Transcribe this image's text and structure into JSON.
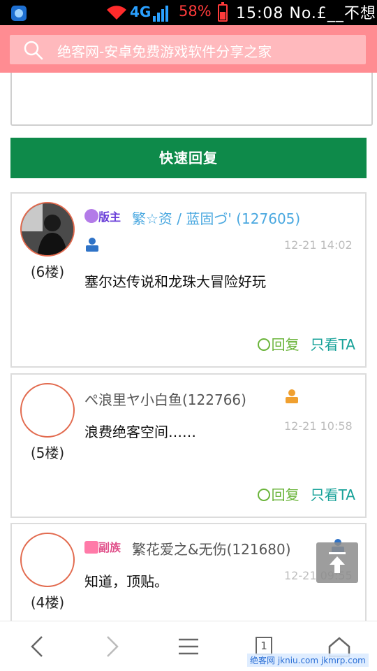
{
  "status_bar": {
    "network": "4G",
    "battery": "58%",
    "time_text": "15:08 No.£__不想"
  },
  "search": {
    "placeholder": "绝客网-安卓免费游戏软件分享之家"
  },
  "quick_reply_label": "快速回复",
  "posts": [
    {
      "floor": "(6楼)",
      "badge": "版主",
      "username": "繁☆资 / 蓝固づ' (127605)",
      "timestamp": "12-21 14:02",
      "content": "塞尔达传说和龙珠大冒险好玩",
      "reply_label": "回复",
      "only_ta_label": "只看TA"
    },
    {
      "floor": "(5楼)",
      "username": "ぺ浪里ヤ小白鱼(122766)",
      "timestamp": "12-21 10:58",
      "content": "浪费绝客空间……",
      "reply_label": "回复",
      "only_ta_label": "只看TA"
    },
    {
      "floor": "(4楼)",
      "badge": "副族",
      "username": "繁花爱之&无伤(121680)",
      "timestamp": "12-21 09:55",
      "content": "知道，顶贴。"
    }
  ],
  "bottom_nav": {
    "tab_count": "1"
  },
  "watermark": "绝客网 jkniu.com jkmrp.com",
  "colors": {
    "header": "#ff8c92",
    "quick_reply": "#0e8a4a",
    "reply_action": "#6ab43a",
    "only_ta_action": "#1aa39a",
    "username_mod": "#4aa8e0",
    "username_plain": "#555555"
  }
}
